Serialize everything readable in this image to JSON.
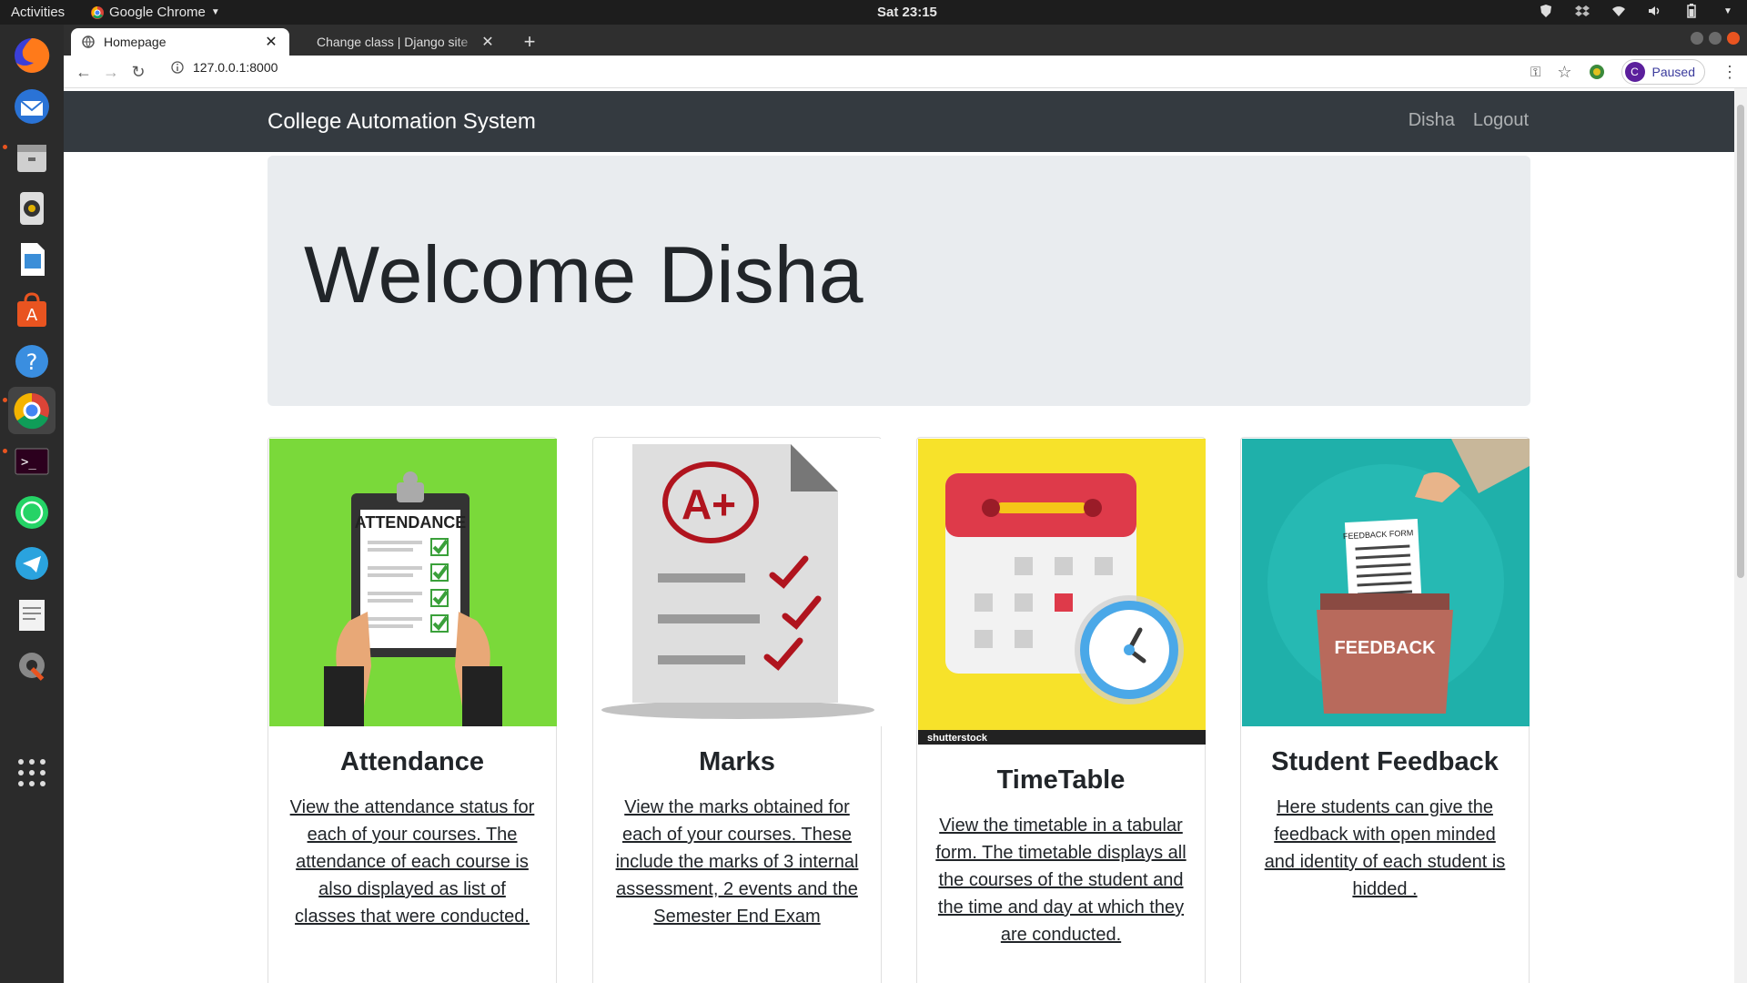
{
  "os": {
    "activities_label": "Activities",
    "app_menu_label": "Google Chrome",
    "clock": "Sat 23:15"
  },
  "browser": {
    "tabs": [
      {
        "title": "Homepage",
        "active": true
      },
      {
        "title": "Change class | Django site",
        "active": false
      }
    ],
    "url": "127.0.0.1:8000",
    "profile_initial": "C",
    "profile_status": "Paused"
  },
  "site": {
    "brand": "College Automation System",
    "nav": {
      "user": "Disha",
      "logout": "Logout"
    },
    "welcome": "Welcome Disha",
    "cards": [
      {
        "title": "Attendance",
        "text": "View the attendance status for each of your courses. The attendance of each course is also displayed as list of classes that were conducted.",
        "image": "attendance-clipboard",
        "bg": "#7ad93a"
      },
      {
        "title": "Marks",
        "text": "View the marks obtained for each of your courses. These include the marks of 3 internal assessment, 2 events and the Semester End Exam",
        "image": "marks-document",
        "grade": "A+",
        "bg": "#ffffff"
      },
      {
        "title": "TimeTable",
        "text": "View the timetable in a tabular form. The timetable displays all the courses of the student and the time and day at which they are conducted.",
        "image": "calendar-clock",
        "watermark": "shutterstock",
        "bg": "#f7e22a"
      },
      {
        "title": "Student Feedback",
        "text": "Here students can give the feedback with open minded and identity of each student is hidded .",
        "image": "feedback-box",
        "form_label": "FEEDBACK FORM",
        "box_label": "FEEDBACK",
        "bg": "#1fb0aa"
      }
    ]
  }
}
